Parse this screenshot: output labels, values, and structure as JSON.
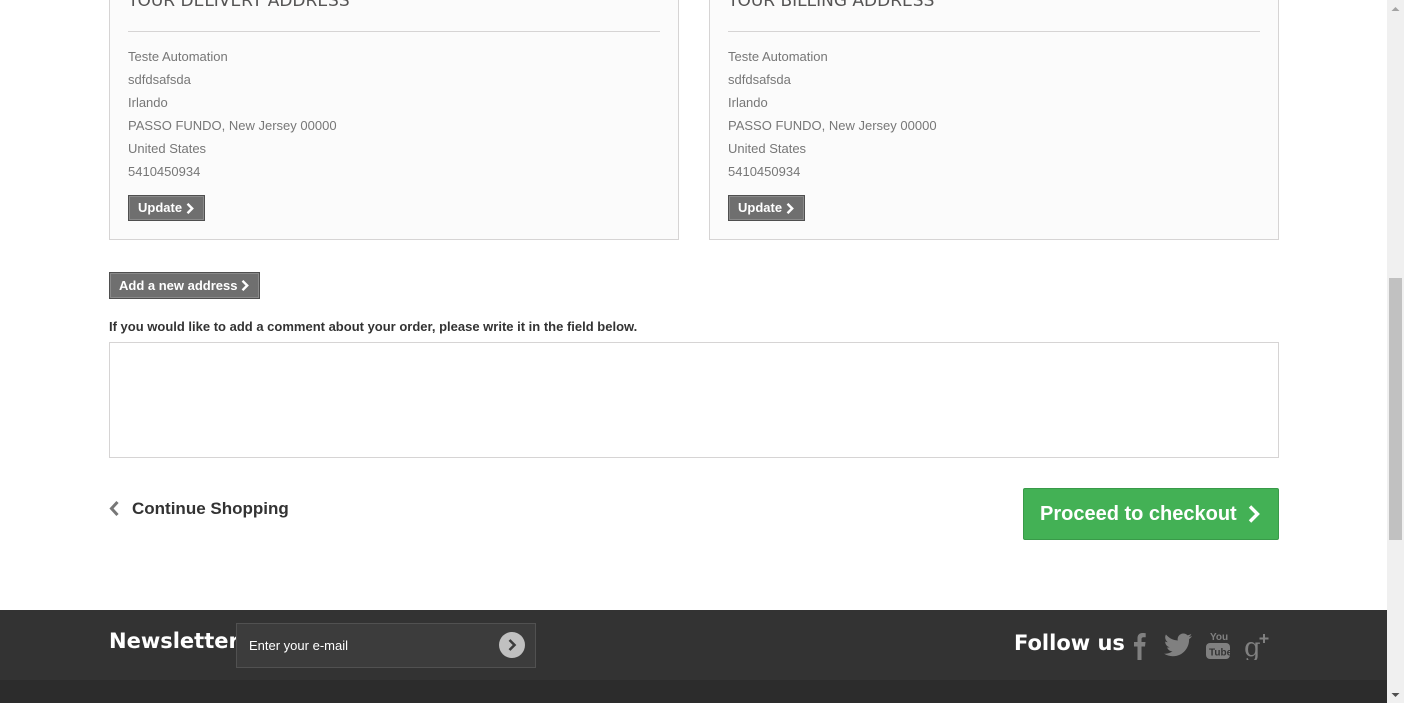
{
  "delivery": {
    "title": "Your delivery address",
    "lines": [
      "Teste Automation",
      "sdfdsafsda",
      "Irlando",
      "PASSO FUNDO, New Jersey 00000",
      "United States",
      "5410450934"
    ],
    "update_label": "Update"
  },
  "billing": {
    "title": "Your billing address",
    "lines": [
      "Teste Automation",
      "sdfdsafsda",
      "Irlando",
      "PASSO FUNDO, New Jersey 00000",
      "United States",
      "5410450934"
    ],
    "update_label": "Update"
  },
  "add_address_label": "Add a new address",
  "comment": {
    "label": "If you would like to add a comment about your order, please write it in the field below.",
    "value": ""
  },
  "continue_label": "Continue Shopping",
  "checkout_label": "Proceed to checkout",
  "footer": {
    "newsletter_title": "Newsletter",
    "newsletter_placeholder": "Enter your e-mail",
    "follow_title": "Follow us",
    "social_icons": [
      "facebook-icon",
      "twitter-icon",
      "youtube-icon",
      "google-plus-icon"
    ]
  },
  "colors": {
    "checkout_green": "#43b155",
    "footer_bg": "#333333",
    "button_dark": "#6f6f6f"
  }
}
